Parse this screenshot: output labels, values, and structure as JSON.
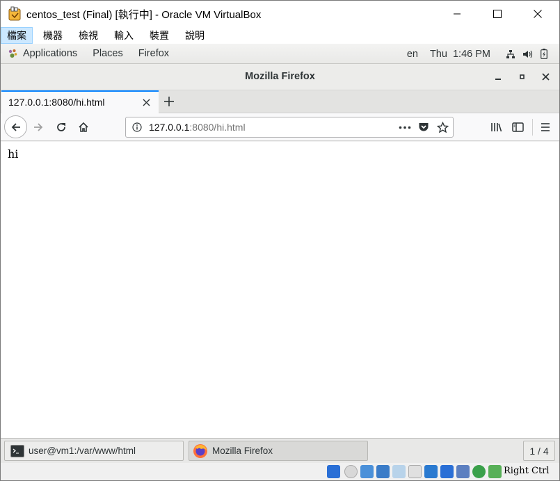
{
  "vbox": {
    "title": "centos_test (Final) [執行中] - Oracle VM VirtualBox",
    "menu": [
      "檔案",
      "機器",
      "檢視",
      "輸入",
      "裝置",
      "說明"
    ],
    "host_key": "Right Ctrl"
  },
  "gnome": {
    "menus": [
      "Applications",
      "Places",
      "Firefox"
    ],
    "keyboard_layout": "en",
    "clock": "Thu  1:46 PM"
  },
  "firefox": {
    "window_title": "Mozilla Firefox",
    "tab_label": "127.0.0.1:8080/hi.html",
    "url_host": "127.0.0.1",
    "url_rest": ":8080/hi.html",
    "page_text": "hi"
  },
  "taskbar": {
    "items": [
      "user@vm1:/var/www/html",
      "Mozilla Firefox"
    ],
    "workspace": "1 / 4"
  },
  "colors": {
    "tab_accent": "#0a84ff",
    "menu_highlight": "#cce8ff",
    "firefox_orange": "#ff7139"
  }
}
